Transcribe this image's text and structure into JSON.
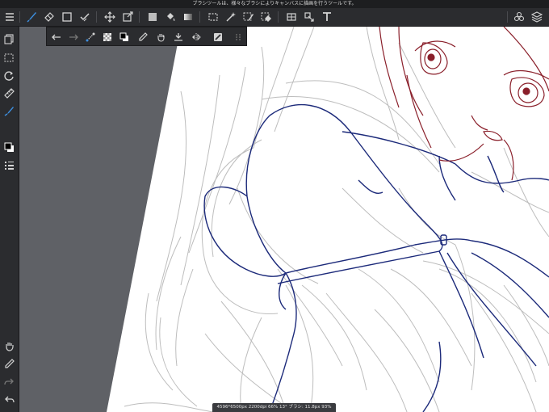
{
  "status": {
    "text": "ブラシツールは、様々なブラシによりキャンバスに描画を行うツールです。"
  },
  "top_toolbar": {
    "tools": [
      "menu-icon",
      "brush-icon",
      "eraser-icon",
      "shape-icon",
      "fill-check-icon",
      "move-icon",
      "transform-icon",
      "color-fill-icon",
      "bucket-icon",
      "gradation-icon",
      "select-icon",
      "magic-wand-icon",
      "select-pen-icon",
      "select-eraser-icon",
      "filter-icon",
      "material-icon",
      "text-icon",
      "brush-material-icon",
      "layers-icon"
    ]
  },
  "sub_toolbar": {
    "tools": [
      "undo-icon",
      "redo-icon",
      "transform-icon",
      "transparency-icon",
      "color-swap-icon",
      "eyedropper-icon",
      "hand-icon",
      "import-icon",
      "flip-icon",
      "snap-icon",
      "more-icon"
    ]
  },
  "left_toolbar": {
    "tools": [
      "layers-panel-icon",
      "select-panel-icon",
      "rotate-icon",
      "ruler-icon",
      "brush-pen-icon",
      "color-swatch-icon",
      "brush-size-icon",
      "hand-icon",
      "eyedropper-icon",
      "redo-icon",
      "undo-icon"
    ]
  },
  "info": {
    "text": "4596*6500px 2200dpi 66% 13° ブラシ: 11.8px 93%"
  },
  "colors": {
    "accent": "#3d8fe0",
    "toolbar_bg": "#2b2c2f",
    "canvas_bg": "#ffffff",
    "outside_bg": "#5f6166",
    "sketch": "#bdbdbd",
    "lineart_blue": "#1c2a7a",
    "lineart_red": "#8a1f2a"
  }
}
